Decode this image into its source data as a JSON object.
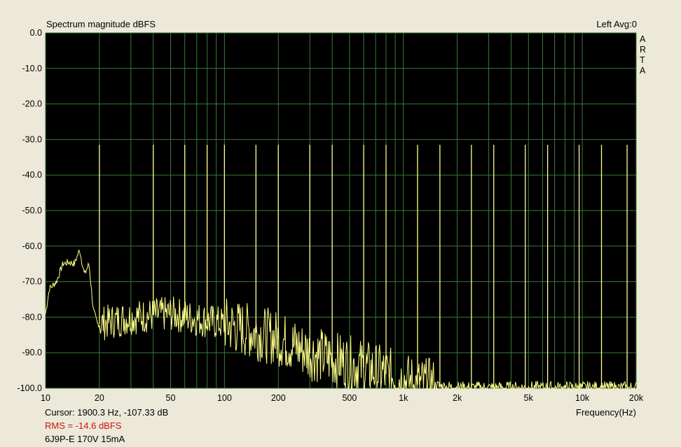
{
  "chart_data": {
    "type": "line",
    "title": "Spectrum magnitude dBFS",
    "channel_info": "Left  Avg:0",
    "brand": "ARTA",
    "xlabel": "Frequency(Hz)",
    "ylabel": "",
    "x_scale": "log",
    "xlim": [
      10,
      20000
    ],
    "ylim": [
      -100,
      0
    ],
    "grid": true,
    "y_ticks": [
      0,
      -10,
      -20,
      -30,
      -40,
      -50,
      -60,
      -70,
      -80,
      -90,
      -100
    ],
    "y_tick_labels": [
      "0.0",
      "-10.0",
      "-20.0",
      "-30.0",
      "-40.0",
      "-50.0",
      "-60.0",
      "-70.0",
      "-80.0",
      "-90.0",
      "-100.0"
    ],
    "x_ticks": [
      10,
      20,
      50,
      100,
      200,
      500,
      1000,
      2000,
      5000,
      10000,
      20000
    ],
    "x_tick_labels": [
      "10",
      "20",
      "50",
      "100",
      "200",
      "500",
      "1k",
      "2k",
      "5k",
      "10k",
      "20k"
    ],
    "line_color": "#FFFF88",
    "background": "#000000",
    "grid_color": "#3A7A3A",
    "fundamental_hz": 20,
    "harmonic_peaks": [
      {
        "x": 20,
        "y": -31.5
      },
      {
        "x": 40,
        "y": -31.5
      },
      {
        "x": 60,
        "y": -31.5
      },
      {
        "x": 80,
        "y": -31.5
      },
      {
        "x": 100,
        "y": -31.5
      },
      {
        "x": 150,
        "y": -31.5
      },
      {
        "x": 200,
        "y": -31.5
      },
      {
        "x": 300,
        "y": -31.5
      },
      {
        "x": 400,
        "y": -31.5
      },
      {
        "x": 600,
        "y": -31.5
      },
      {
        "x": 800,
        "y": -31.5
      },
      {
        "x": 1200,
        "y": -31.5
      },
      {
        "x": 1600,
        "y": -31.5
      },
      {
        "x": 2400,
        "y": -31.5
      },
      {
        "x": 3200,
        "y": -31.5
      },
      {
        "x": 4800,
        "y": -31.5
      },
      {
        "x": 6400,
        "y": -31.5
      },
      {
        "x": 9600,
        "y": -31.5
      },
      {
        "x": 12800,
        "y": -31.5
      },
      {
        "x": 17800,
        "y": -31.5
      }
    ],
    "noise_floor": [
      {
        "x": 10,
        "y": -79
      },
      {
        "x": 10.5,
        "y": -72
      },
      {
        "x": 11.5,
        "y": -70
      },
      {
        "x": 12.5,
        "y": -65
      },
      {
        "x": 13.5,
        "y": -64.5
      },
      {
        "x": 14.5,
        "y": -65
      },
      {
        "x": 15.5,
        "y": -61
      },
      {
        "x": 16.5,
        "y": -68
      },
      {
        "x": 17.5,
        "y": -65
      },
      {
        "x": 18.5,
        "y": -78
      },
      {
        "x": 19.5,
        "y": -82
      },
      {
        "x": 30,
        "y": -80
      },
      {
        "x": 50,
        "y": -79
      },
      {
        "x": 100,
        "y": -82
      },
      {
        "x": 200,
        "y": -86
      },
      {
        "x": 300,
        "y": -90
      },
      {
        "x": 500,
        "y": -93
      },
      {
        "x": 800,
        "y": -96
      },
      {
        "x": 1200,
        "y": -99
      },
      {
        "x": 2000,
        "y": -100
      },
      {
        "x": 20000,
        "y": -100
      }
    ]
  },
  "status": {
    "cursor": "Cursor:  1900.3 Hz, -107.33 dB",
    "rms": "RMS =  -14.6 dBFS",
    "note": "6J9P-E 170V 15mA"
  }
}
